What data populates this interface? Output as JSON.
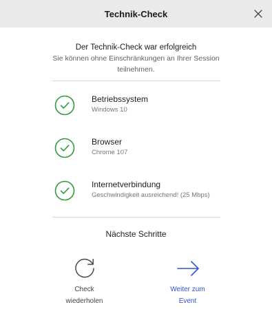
{
  "header": {
    "title": "Technik-Check",
    "close_icon": "close-icon"
  },
  "intro": {
    "title": "Der Technik-Check war erfolgreich",
    "text": "Sie können ohne Einschränkungen an Ihrer Session teilnehmen."
  },
  "checks": [
    {
      "title": "Betriebssystem",
      "detail": "Windows 10",
      "icon": "check-circle-icon",
      "status": "ok"
    },
    {
      "title": "Browser",
      "detail": "Chrome 107",
      "icon": "check-circle-icon",
      "status": "ok"
    },
    {
      "title": "Internetverbindung",
      "detail": "Geschwindigkeit ausreichend! (25 Mbps)",
      "icon": "check-circle-icon",
      "status": "ok"
    }
  ],
  "next_steps": {
    "title": "Nächste Schritte",
    "retry": {
      "label": "Check wiederholen",
      "icon": "refresh-icon"
    },
    "continue": {
      "label": "Weiter zum Event",
      "icon": "arrow-right-icon"
    }
  },
  "colors": {
    "success": "#2e9a3c",
    "accent": "#2f52d9",
    "header_bg": "#eaeaea"
  }
}
